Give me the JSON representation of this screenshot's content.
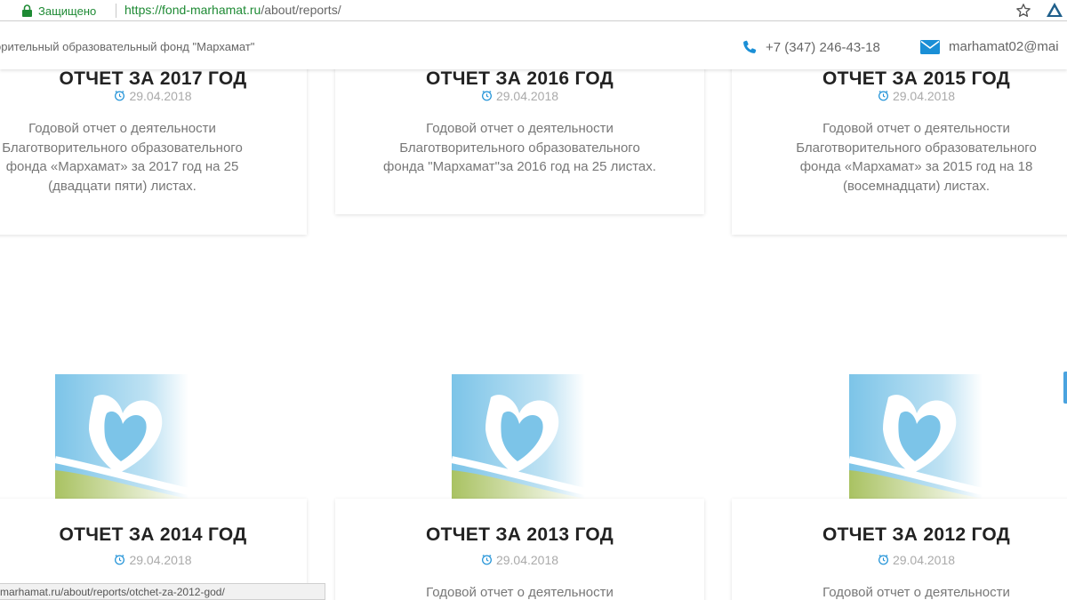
{
  "browser": {
    "secure_label": "Защищено",
    "url_proto": "https://",
    "url_host": "fond-marhamat.ru",
    "url_path": "/about/reports/"
  },
  "header": {
    "site_title": "орительный образовательный фонд \"Мархамат\"",
    "phone": "+7 (347) 246-43-18",
    "email": "marhamat02@mai"
  },
  "cards": [
    {
      "title": "ОТЧЕТ ЗА 2017 ГОД",
      "date": "29.04.2018",
      "desc_lines": [
        "Годовой отчет о деятельности",
        "Благотворительного образовательного",
        "фонда «Мархамат» за 2017 год на 25",
        "(двадцати пяти) листах."
      ]
    },
    {
      "title": "ОТЧЕТ ЗА 2016 ГОД",
      "date": "29.04.2018",
      "desc_lines": [
        "Годовой отчет о деятельности",
        "Благотворительного образовательного",
        "фонда \"Мархамат\"за 2016 год на 25 листах."
      ]
    },
    {
      "title": "ОТЧЕТ ЗА 2015 ГОД",
      "date": "29.04.2018",
      "desc_lines": [
        "Годовой отчет о деятельности",
        "Благотворительного образовательного",
        "фонда «Мархамат» за 2015 год на 18",
        "(восемнадцати) листах."
      ]
    },
    {
      "title": "ОТЧЕТ ЗА 2014 ГОД",
      "date": "29.04.2018",
      "desc_lines": []
    },
    {
      "title": "ОТЧЕТ ЗА 2013 ГОД",
      "date": "29.04.2018",
      "desc_lines": [
        "Годовой отчет о деятельности"
      ]
    },
    {
      "title": "ОТЧЕТ ЗА 2012 ГОД",
      "date": "29.04.2018",
      "desc_lines": [
        "Годовой отчет о деятельности"
      ]
    }
  ],
  "status_bar_url": "marhamat.ru/about/reports/otchet-za-2012-god/",
  "colors": {
    "secure_green": "#1e8a34",
    "icon_blue": "#1a8fd6",
    "logo_blue": "#7cc4e8",
    "logo_green": "#b9cc7a"
  },
  "icons": [
    "lock-icon",
    "star-icon",
    "extension-icon",
    "phone-icon",
    "mail-icon",
    "clock-icon",
    "fund-logo"
  ]
}
